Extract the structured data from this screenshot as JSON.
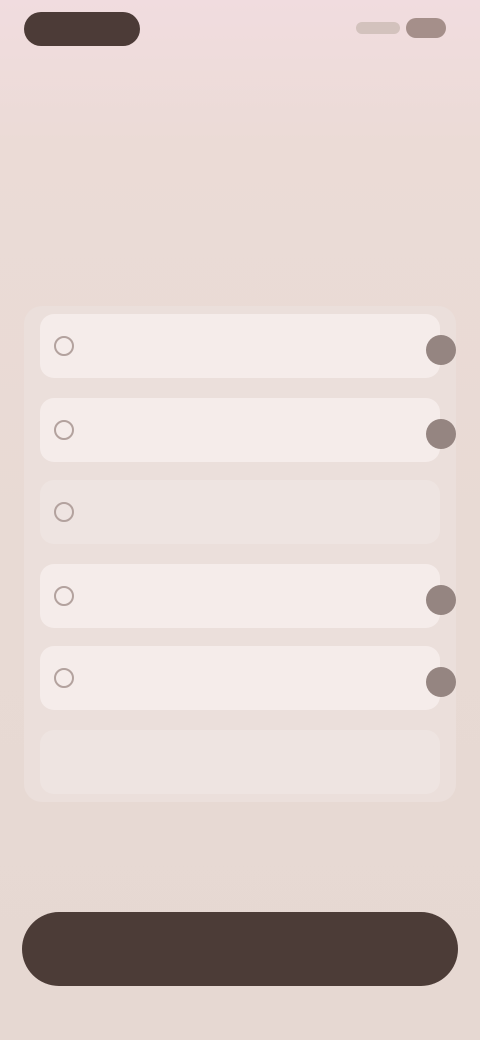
{
  "header": {
    "title": "",
    "subtitle": ""
  },
  "options": [
    {
      "label": "",
      "icon": "circle-icon",
      "selected": true
    },
    {
      "label": "",
      "icon": "circle-icon",
      "selected": true
    },
    {
      "label": "",
      "icon": "circle-icon",
      "selected": false
    },
    {
      "label": "",
      "icon": "circle-icon",
      "selected": true
    },
    {
      "label": "",
      "icon": "circle-icon",
      "selected": true
    },
    {
      "label": "",
      "icon": "",
      "selected": false
    }
  ],
  "footer": {
    "continue_label": ""
  },
  "colors": {
    "accent": "#4c3c37",
    "background": "#e8dad4",
    "selected_indicator": "#958581"
  }
}
